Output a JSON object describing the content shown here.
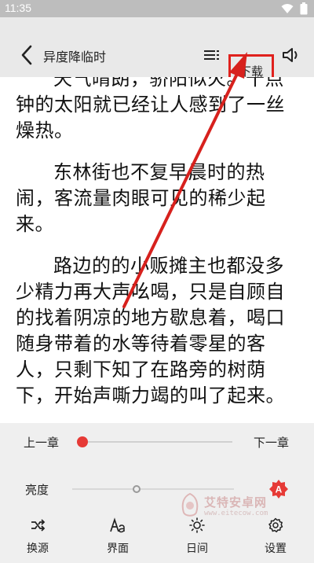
{
  "status_bar": {
    "time": "11:35"
  },
  "header": {
    "book_title": "异度降临时",
    "download_label": "下载"
  },
  "reader": {
    "paragraphs": [
      "天气晴朗，骄阳似火。十点钟的太阳就已经让人感到了一丝燥热。",
      "东林街也不复早晨时的热闹，客流量肉眼可见的稀少起来。",
      "路边的的小贩摊主也都没多少精力再大声吆喝，只是自顾自的找着阴凉的地方歇息着，喝口随身带着的水等待着零星的客人，只剩下知了在路旁的树荫下，开始声嘶力竭的叫了起来。"
    ]
  },
  "panel": {
    "prev_chapter": "上一章",
    "next_chapter": "下一章",
    "chapter_progress": 0.0,
    "brightness_label": "亮度",
    "brightness_level": 0.4,
    "auto_brightness_badge": "A",
    "watermark": {
      "text": "艾特安卓网",
      "sub": "www.eitecow.com"
    }
  },
  "bottom_nav": [
    {
      "label": "换源",
      "icon": "swap-source-icon"
    },
    {
      "label": "界面",
      "icon": "font-aa-icon"
    },
    {
      "label": "日间",
      "icon": "sun-icon"
    },
    {
      "label": "设置",
      "icon": "gear-icon"
    }
  ],
  "colors": {
    "accent": "#e63a36",
    "annotation": "#e0211d",
    "toolbar_bg": "#e9e9e9",
    "panel_bg": "#efefef"
  }
}
